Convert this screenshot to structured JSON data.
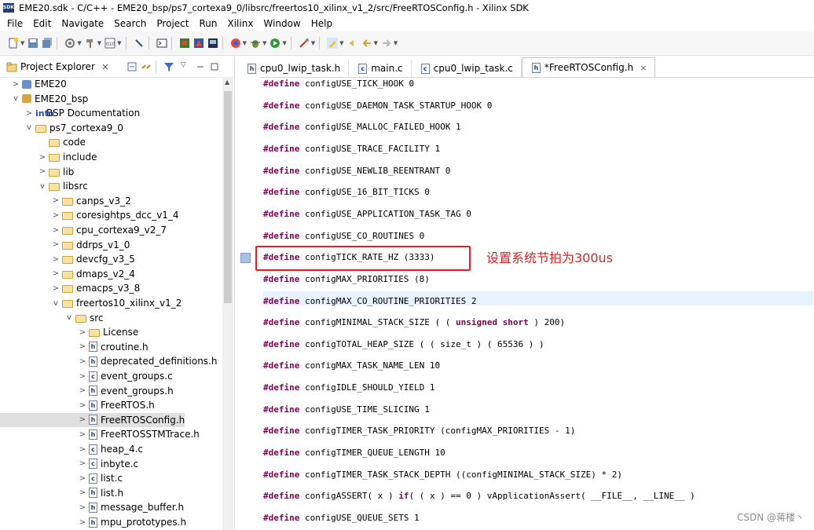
{
  "window": {
    "app_icon": "SDK",
    "title": "EME20.sdk - C/C++ - EME20_bsp/ps7_cortexa9_0/libsrc/freertos10_xilinx_v1_2/src/FreeRTOSConfig.h - Xilinx SDK"
  },
  "menu": [
    "File",
    "Edit",
    "Navigate",
    "Search",
    "Project",
    "Run",
    "Xilinx",
    "Window",
    "Help"
  ],
  "project_explorer": {
    "title": "Project Explorer",
    "close": "×",
    "tree": [
      {
        "depth": 0,
        "expand": ">",
        "icon": "proj",
        "label": "EME20"
      },
      {
        "depth": 0,
        "expand": "v",
        "icon": "bsp",
        "label": "EME20_bsp"
      },
      {
        "depth": 1,
        "expand": ">",
        "icon": "info",
        "label": "BSP Documentation"
      },
      {
        "depth": 1,
        "expand": "v",
        "icon": "folder",
        "label": "ps7_cortexa9_0"
      },
      {
        "depth": 2,
        "expand": "",
        "icon": "folder",
        "label": "code"
      },
      {
        "depth": 2,
        "expand": ">",
        "icon": "folder",
        "label": "include"
      },
      {
        "depth": 2,
        "expand": ">",
        "icon": "folder",
        "label": "lib"
      },
      {
        "depth": 2,
        "expand": "v",
        "icon": "folder",
        "label": "libsrc"
      },
      {
        "depth": 3,
        "expand": ">",
        "icon": "folder",
        "label": "canps_v3_2"
      },
      {
        "depth": 3,
        "expand": ">",
        "icon": "folder",
        "label": "coresightps_dcc_v1_4"
      },
      {
        "depth": 3,
        "expand": ">",
        "icon": "folder",
        "label": "cpu_cortexa9_v2_7"
      },
      {
        "depth": 3,
        "expand": ">",
        "icon": "folder",
        "label": "ddrps_v1_0"
      },
      {
        "depth": 3,
        "expand": ">",
        "icon": "folder",
        "label": "devcfg_v3_5"
      },
      {
        "depth": 3,
        "expand": ">",
        "icon": "folder",
        "label": "dmaps_v2_4"
      },
      {
        "depth": 3,
        "expand": ">",
        "icon": "folder",
        "label": "emacps_v3_8"
      },
      {
        "depth": 3,
        "expand": "v",
        "icon": "folder",
        "label": "freertos10_xilinx_v1_2"
      },
      {
        "depth": 4,
        "expand": "v",
        "icon": "folder",
        "label": "src"
      },
      {
        "depth": 5,
        "expand": ">",
        "icon": "folder",
        "label": "License"
      },
      {
        "depth": 5,
        "expand": ">",
        "icon": "h",
        "label": "croutine.h"
      },
      {
        "depth": 5,
        "expand": ">",
        "icon": "h",
        "label": "deprecated_definitions.h"
      },
      {
        "depth": 5,
        "expand": ">",
        "icon": "c",
        "label": "event_groups.c"
      },
      {
        "depth": 5,
        "expand": ">",
        "icon": "h",
        "label": "event_groups.h"
      },
      {
        "depth": 5,
        "expand": ">",
        "icon": "h",
        "label": "FreeRTOS.h"
      },
      {
        "depth": 5,
        "expand": ">",
        "icon": "h",
        "label": "FreeRTOSConfig.h",
        "selected": true
      },
      {
        "depth": 5,
        "expand": ">",
        "icon": "h",
        "label": "FreeRTOSSTMTrace.h"
      },
      {
        "depth": 5,
        "expand": ">",
        "icon": "c",
        "label": "heap_4.c"
      },
      {
        "depth": 5,
        "expand": ">",
        "icon": "c",
        "label": "inbyte.c"
      },
      {
        "depth": 5,
        "expand": ">",
        "icon": "c",
        "label": "list.c"
      },
      {
        "depth": 5,
        "expand": ">",
        "icon": "h",
        "label": "list.h"
      },
      {
        "depth": 5,
        "expand": ">",
        "icon": "h",
        "label": "message_buffer.h"
      },
      {
        "depth": 5,
        "expand": ">",
        "icon": "h",
        "label": "mpu_prototypes.h"
      }
    ]
  },
  "editor": {
    "tabs": [
      {
        "icon": "h",
        "label": "cpu0_lwip_task.h",
        "active": false
      },
      {
        "icon": "c",
        "label": "main.c",
        "active": false
      },
      {
        "icon": "c",
        "label": "cpu0_lwip_task.c",
        "active": false
      },
      {
        "icon": "h",
        "label": "*FreeRTOSConfig.h",
        "active": true,
        "close": "×"
      }
    ],
    "lines": [
      {
        "kw": "#define",
        "text": " configUSE_TICK_HOOK 0"
      },
      {
        "kw": "#define",
        "text": " configUSE_DAEMON_TASK_STARTUP_HOOK 0"
      },
      {
        "kw": "#define",
        "text": " configUSE_MALLOC_FAILED_HOOK 1"
      },
      {
        "kw": "#define",
        "text": " configUSE_TRACE_FACILITY 1"
      },
      {
        "kw": "#define",
        "text": " configUSE_NEWLIB_REENTRANT 0"
      },
      {
        "kw": "#define",
        "text": " configUSE_16_BIT_TICKS 0"
      },
      {
        "kw": "#define",
        "text": " configUSE_APPLICATION_TASK_TAG 0"
      },
      {
        "kw": "#define",
        "text": " configUSE_CO_ROUTINES 0"
      },
      {
        "kw": "#define",
        "text": " configTICK_RATE_HZ (3333)",
        "marked": true,
        "boxed": true
      },
      {
        "kw": "#define",
        "text": " configMAX_PRIORITIES (8)"
      },
      {
        "kw": "#define",
        "text": " configMAX_CO_ROUTINE_PRIORITIES 2"
      },
      {
        "kw": "#define",
        "text": " configMINIMAL_STACK_SIZE ( ( ",
        "kw2": "unsigned short",
        "text2": " ) 200)"
      },
      {
        "kw": "#define",
        "text": " configTOTAL_HEAP_SIZE ( ( size_t ) ( 65536 ) )"
      },
      {
        "kw": "#define",
        "text": " configMAX_TASK_NAME_LEN 10"
      },
      {
        "kw": "#define",
        "text": " configIDLE_SHOULD_YIELD 1"
      },
      {
        "kw": "#define",
        "text": " configUSE_TIME_SLICING 1"
      },
      {
        "kw": "#define",
        "text": " configTIMER_TASK_PRIORITY (configMAX_PRIORITIES - 1)"
      },
      {
        "kw": "#define",
        "text": " configTIMER_QUEUE_LENGTH 10"
      },
      {
        "kw": "#define",
        "text": " configTIMER_TASK_STACK_DEPTH ((configMINIMAL_STACK_SIZE) * 2)"
      },
      {
        "kw": "#define",
        "text": " configASSERT( x ) ",
        "kw2": "if",
        "text2": "( ( x ) == 0 ) vApplicationAssert( __FILE__, __LINE__ )"
      },
      {
        "kw": "#define",
        "text": " configUSE_QUEUE_SETS 1"
      }
    ],
    "annotation": "设置系统节拍为300us"
  },
  "watermark": "CSDN @蒋楼丶",
  "colors": {
    "keyword": "#7f0055",
    "annotation": "#e02020",
    "selection": "#e0e0e0"
  }
}
